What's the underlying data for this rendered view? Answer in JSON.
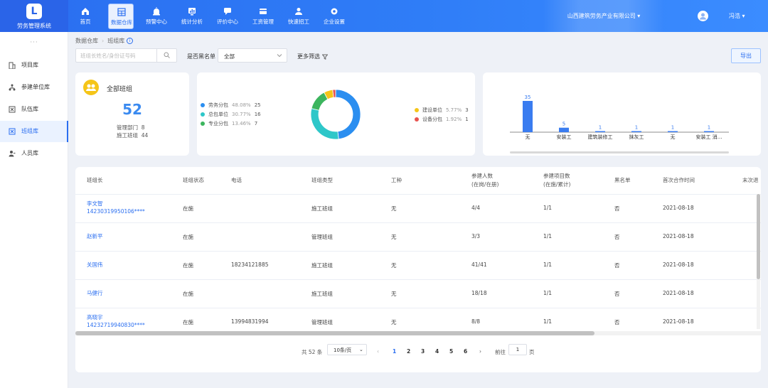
{
  "app": {
    "name": "劳务管理系统",
    "logo_letter": "L"
  },
  "nav": [
    {
      "label": "首页",
      "icon": "home-icon"
    },
    {
      "label": "数据仓库",
      "icon": "table-icon",
      "active": true
    },
    {
      "label": "预警中心",
      "icon": "alarm-icon"
    },
    {
      "label": "统计分析",
      "icon": "stats-icon"
    },
    {
      "label": "评价中心",
      "icon": "chat-icon"
    },
    {
      "label": "工资管理",
      "icon": "wallet-icon"
    },
    {
      "label": "快速招工",
      "icon": "worker-icon"
    },
    {
      "label": "企业设置",
      "icon": "gear-icon"
    }
  ],
  "header": {
    "company": "山西建筑劳务产业有限公司",
    "user": "冯浩"
  },
  "sidebar": {
    "collapse": "···",
    "items": [
      {
        "label": "项目库",
        "icon": "building-icon"
      },
      {
        "label": "参建单位库",
        "icon": "org-icon"
      },
      {
        "label": "队伍库",
        "icon": "team-icon"
      },
      {
        "label": "班组库",
        "icon": "group-icon",
        "active": true
      },
      {
        "label": "人员库",
        "icon": "person-icon"
      }
    ]
  },
  "breadcrumb": {
    "root": "数据仓库",
    "current": "班组库",
    "info": "i"
  },
  "filters": {
    "search_placeholder": "班组长姓名/身份证号码",
    "blacklist_label": "是否黑名单",
    "blacklist_value": "全部",
    "more_label": "更多筛选",
    "export_label": "导出"
  },
  "summary": {
    "title": "全部班组",
    "total": "52",
    "dept_label": "管理部门",
    "dept_value": "8",
    "team_label": "施工班组",
    "team_value": "44"
  },
  "donut": {
    "legend": [
      {
        "name": "劳务分包",
        "pct": "48.08%",
        "count": "25",
        "color": "#2b8ef0",
        "value": 25
      },
      {
        "name": "总包单位",
        "pct": "30.77%",
        "count": "16",
        "color": "#2ec7c9",
        "value": 16
      },
      {
        "name": "专业分包",
        "pct": "13.46%",
        "count": "7",
        "color": "#3cb55e",
        "value": 7
      },
      {
        "name": "建设单位",
        "pct": "5.77%",
        "count": "3",
        "color": "#f5c518",
        "value": 3
      },
      {
        "name": "设备分包",
        "pct": "1.92%",
        "count": "1",
        "color": "#e8534f",
        "value": 1
      }
    ]
  },
  "chart_data": {
    "type": "bar",
    "categories": [
      "无",
      "安装工",
      "建筑装修工",
      "抹灰工",
      "无",
      "安装工 消..."
    ],
    "values": [
      35,
      5,
      1,
      1,
      1,
      1
    ],
    "ylim": [
      0,
      35
    ],
    "color": "#3a7cf0"
  },
  "table": {
    "columns": [
      {
        "label": "班组长"
      },
      {
        "label": "班组状态"
      },
      {
        "label": "电话"
      },
      {
        "label": "班组类型"
      },
      {
        "label": "工种"
      },
      {
        "label": "参建人数",
        "sub": "(在岗/在册)"
      },
      {
        "label": "参建项目数",
        "sub": "(在施/累计)"
      },
      {
        "label": "黑名单"
      },
      {
        "label": "首次合作时间"
      },
      {
        "label": "末次退"
      }
    ],
    "rows": [
      {
        "name": "李文智",
        "id": "14230319950106****",
        "status": "在施",
        "phone": "",
        "type": "施工班组",
        "trade": "无",
        "people": "4/4",
        "projects": "1/1",
        "black": "否",
        "date": "2021-08-18"
      },
      {
        "name": "赵新平",
        "id": "",
        "status": "在施",
        "phone": "",
        "type": "管理班组",
        "trade": "无",
        "people": "3/3",
        "projects": "1/1",
        "black": "否",
        "date": "2021-08-18"
      },
      {
        "name": "关国伟",
        "id": "",
        "status": "在施",
        "phone": "18234121885",
        "type": "施工班组",
        "trade": "无",
        "people": "41/41",
        "projects": "1/1",
        "black": "否",
        "date": "2021-08-18"
      },
      {
        "name": "马健行",
        "id": "",
        "status": "在施",
        "phone": "",
        "type": "施工班组",
        "trade": "无",
        "people": "18/18",
        "projects": "1/1",
        "black": "否",
        "date": "2021-08-18"
      },
      {
        "name": "高晓宇",
        "id": "14232719940830****",
        "status": "在施",
        "phone": "13994831994",
        "type": "管理班组",
        "trade": "无",
        "people": "8/8",
        "projects": "1/1",
        "black": "否",
        "date": "2021-08-18"
      }
    ]
  },
  "pagination": {
    "total_text": "共 52 条",
    "page_size": "10条/页",
    "pages": [
      "1",
      "2",
      "3",
      "4",
      "5",
      "6"
    ],
    "goto_label": "前往",
    "goto_value": "1",
    "page_suffix": "页",
    "prev": "‹",
    "next": "›"
  }
}
